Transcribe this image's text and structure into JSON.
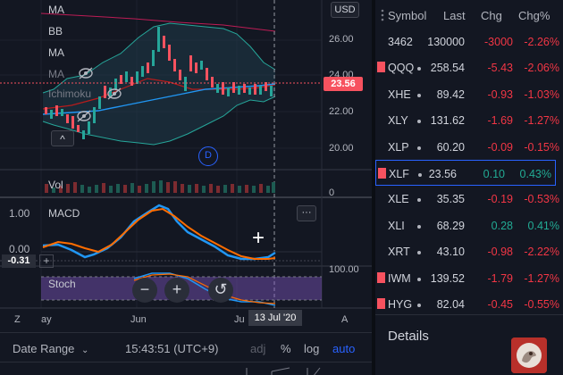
{
  "chart": {
    "price_scale": {
      "currency": "USD",
      "ticks": [
        "26.00",
        "24.00",
        "22.00",
        "20.00"
      ],
      "current_price": "23.56",
      "volume_zero": "0"
    },
    "indicators": [
      {
        "label": "MA"
      },
      {
        "label": "BB"
      },
      {
        "label": "MA"
      },
      {
        "label": "MA"
      },
      {
        "label": "Ichimoku"
      }
    ],
    "marker_d": "D",
    "volume_label": "Vol",
    "macd": {
      "label": "MACD",
      "ticks": [
        "1.00",
        "0.00"
      ],
      "value_badge": "-0.31",
      "plus": "+"
    },
    "stoch": {
      "label": "Stoch",
      "tick": "100.00"
    },
    "time_axis": {
      "labels": [
        "ay",
        "Jun",
        "Ju"
      ],
      "crosshair_date": "13 Jul '20",
      "z_label": "Z",
      "a_label": "A"
    },
    "zoom_controls": {
      "minus": "−",
      "plus": "+",
      "reset": "↺"
    },
    "crosshair_glyph": "+",
    "more_glyph": "···",
    "collapse_glyph": "^"
  },
  "bottom_bar": {
    "date_range": "Date Range",
    "clock": "15:43:51 (UTC+9)",
    "adj": "adj",
    "percent": "%",
    "log": "log",
    "auto": "auto"
  },
  "watchlist": {
    "headers": {
      "symbol": "Symbol",
      "last": "Last",
      "chg": "Chg",
      "chg_pct": "Chg%"
    },
    "rows": [
      {
        "symbol": "3462",
        "last": "130000",
        "chg": "-3000",
        "chg_pct": "-2.26%",
        "dir": "neg",
        "flag": false,
        "dot": false
      },
      {
        "symbol": "QQQ",
        "last": "258.54",
        "chg": "-5.43",
        "chg_pct": "-2.06%",
        "dir": "neg",
        "flag": true,
        "dot": true
      },
      {
        "symbol": "XHE",
        "last": "89.42",
        "chg": "-0.93",
        "chg_pct": "-1.03%",
        "dir": "neg",
        "flag": false,
        "dot": true
      },
      {
        "symbol": "XLY",
        "last": "131.62",
        "chg": "-1.69",
        "chg_pct": "-1.27%",
        "dir": "neg",
        "flag": false,
        "dot": true
      },
      {
        "symbol": "XLP",
        "last": "60.20",
        "chg": "-0.09",
        "chg_pct": "-0.15%",
        "dir": "neg",
        "flag": false,
        "dot": true
      },
      {
        "symbol": "XLF",
        "last": "23.56",
        "chg": "0.10",
        "chg_pct": "0.43%",
        "dir": "pos",
        "flag": true,
        "dot": true,
        "selected": true
      },
      {
        "symbol": "XLE",
        "last": "35.35",
        "chg": "-0.19",
        "chg_pct": "-0.53%",
        "dir": "neg",
        "flag": false,
        "dot": true
      },
      {
        "symbol": "XLI",
        "last": "68.29",
        "chg": "0.28",
        "chg_pct": "0.41%",
        "dir": "pos",
        "flag": false,
        "dot": true
      },
      {
        "symbol": "XRT",
        "last": "43.10",
        "chg": "-0.98",
        "chg_pct": "-2.22%",
        "dir": "neg",
        "flag": false,
        "dot": true
      },
      {
        "symbol": "IWM",
        "last": "139.52",
        "chg": "-1.79",
        "chg_pct": "-1.27%",
        "dir": "neg",
        "flag": true,
        "dot": true
      },
      {
        "symbol": "HYG",
        "last": "82.04",
        "chg": "-0.45",
        "chg_pct": "-0.55%",
        "dir": "neg",
        "flag": true,
        "dot": true
      }
    ],
    "details_label": "Details"
  },
  "colors": {
    "accent": "#2962ff",
    "negative": "#f23645",
    "positive": "#22ab94",
    "background": "#131722",
    "macd_line": "#2196f3",
    "signal_line": "#ff6d00"
  }
}
